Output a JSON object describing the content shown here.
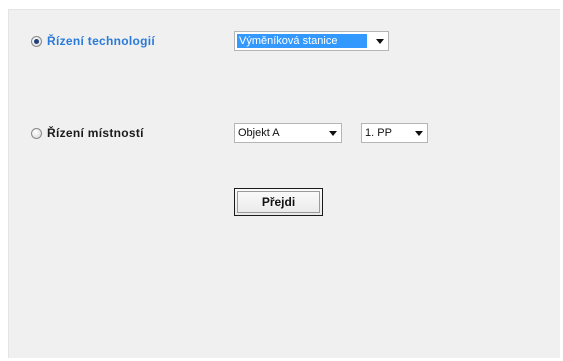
{
  "options": [
    {
      "label": "Řízení technologií",
      "checked": true,
      "selects": [
        {
          "value": "Výměníková stanice",
          "highlighted": true
        }
      ]
    },
    {
      "label": "Řízení místností",
      "checked": false,
      "selects": [
        {
          "value": "Objekt A",
          "highlighted": false
        },
        {
          "value": "1. PP",
          "highlighted": false
        }
      ]
    }
  ],
  "go_button": {
    "label": "Přejdi"
  },
  "colors": {
    "active_label": "#2a7ad8",
    "selection": "#3399ff",
    "window_bg": "#f0f0f0"
  }
}
